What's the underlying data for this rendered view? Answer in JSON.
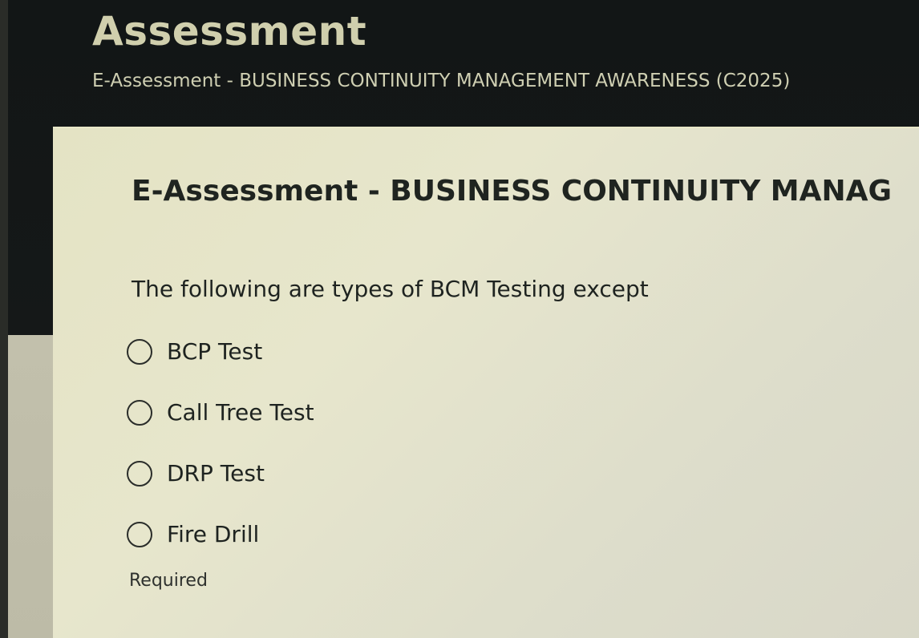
{
  "header": {
    "title": "Assessment",
    "subtitle": "E-Assessment - BUSINESS CONTINUITY MANAGEMENT AWARENESS (C2025)"
  },
  "card": {
    "title": "E-Assessment - BUSINESS CONTINUITY MANAG",
    "question": "The following are types of BCM Testing except",
    "options": [
      {
        "label": "BCP Test"
      },
      {
        "label": "Call Tree Test"
      },
      {
        "label": "DRP Test"
      },
      {
        "label": "Fire Drill"
      }
    ],
    "required_text": "Required"
  },
  "colors": {
    "header_bg": "#141717",
    "header_text": "#d0cfad",
    "card_bg": "#e4e3c4",
    "body_text": "#1e2320"
  }
}
